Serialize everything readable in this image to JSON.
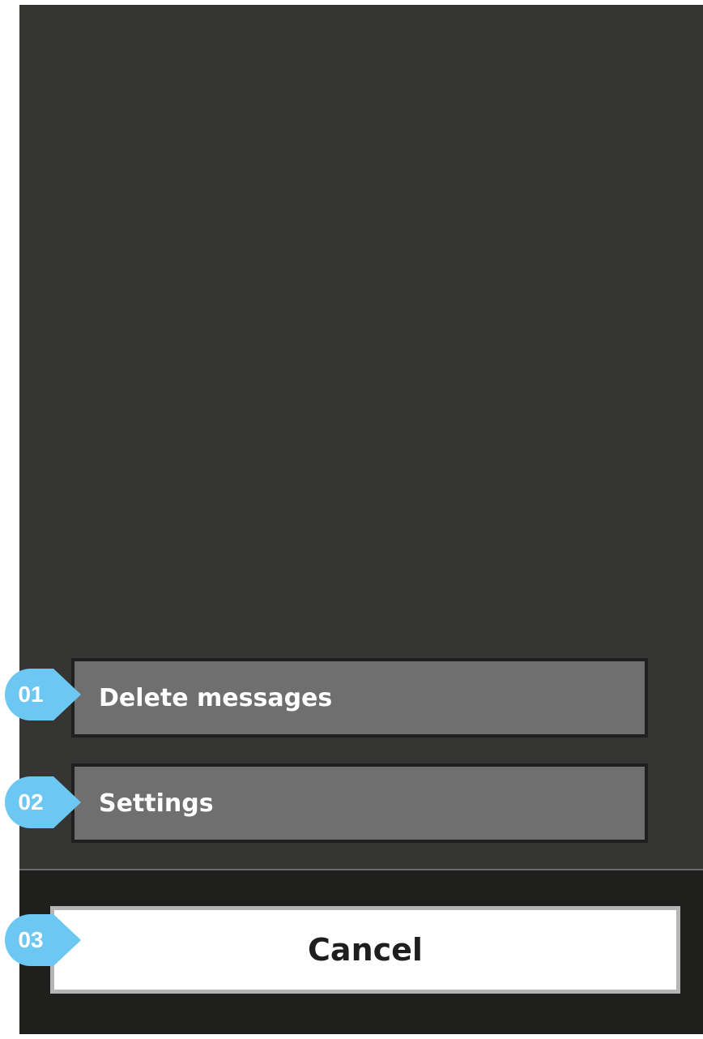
{
  "menu": {
    "items": [
      {
        "label": "Delete messages"
      },
      {
        "label": "Settings"
      }
    ]
  },
  "footer": {
    "cancel_label": "Cancel"
  },
  "markers": [
    "01",
    "02",
    "03"
  ],
  "colors": {
    "screen_background": "#353533",
    "menu_item_background": "#6f6f6f",
    "menu_item_border": "#1f1f1f",
    "footer_background": "#1f1f1d",
    "cancel_background": "#ffffff",
    "cancel_border": "#b5b5b5",
    "marker_fill": "#6cc8f2"
  }
}
